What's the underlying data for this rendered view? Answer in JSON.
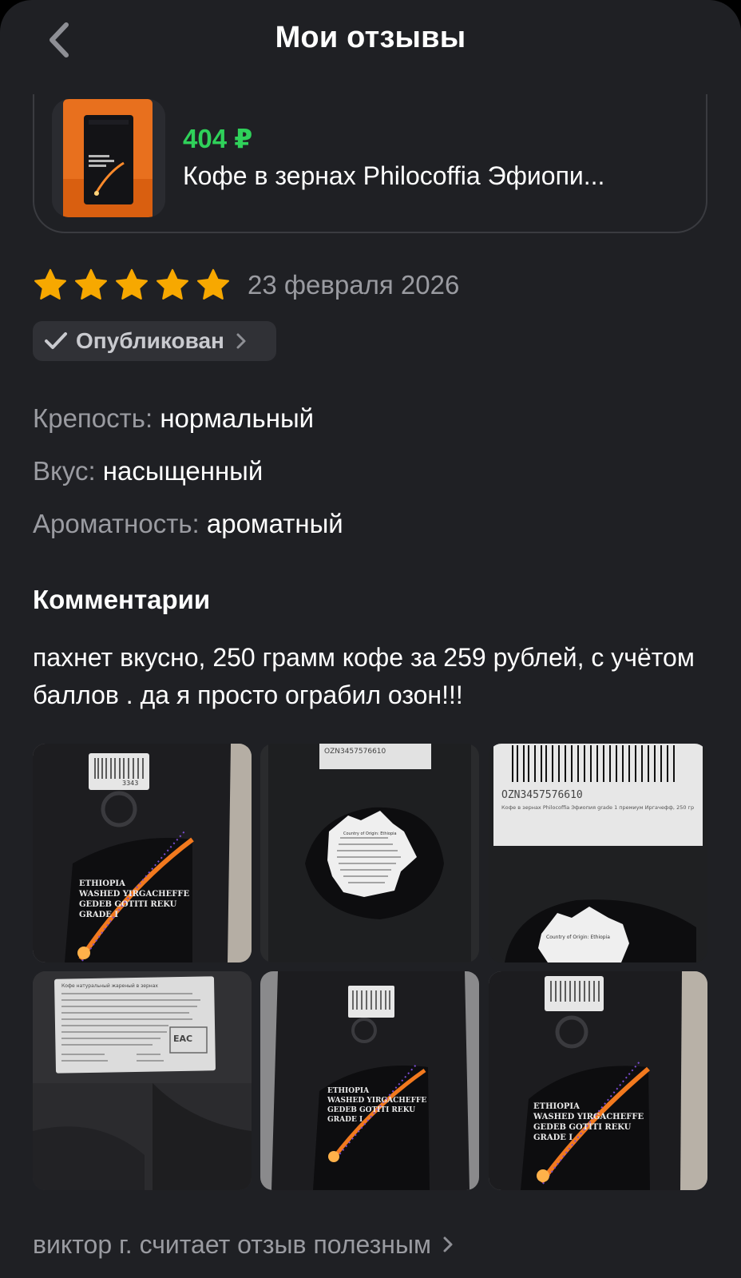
{
  "header": {
    "title": "Мои отзывы",
    "back_icon": "chevron-left-icon"
  },
  "product": {
    "price": "404 ₽",
    "name": "Кофе в зернах Philocoffia Эфиопи..."
  },
  "rating": {
    "stars": 5,
    "max_stars": 5,
    "date": "23 февраля 2026",
    "star_color": "#f7a800"
  },
  "status": {
    "label": "Опубликован",
    "icon": "checkmark-icon"
  },
  "attributes": [
    {
      "key": "Крепость:",
      "value": "нормальный"
    },
    {
      "key": "Вкус:",
      "value": "насыщенный"
    },
    {
      "key": "Ароматность:",
      "value": "ароматный"
    }
  ],
  "comments": {
    "title": "Комментарии",
    "text": "пахнет вкусно, 250 грамм кофе за 259 рублей, с учётом баллов . да я просто ограбил озон!!!"
  },
  "photos": [
    {
      "label_lines": [
        "ETHIOPIA",
        "WASHED YIRGACHEFFE",
        "GEDEB GOTITI REKU",
        "GRADE I"
      ],
      "barcode": "3343"
    },
    {
      "barcode_text": "OZN3457576610",
      "map_text": "Country of Origin: Ethiopia"
    },
    {
      "barcode_text": "OZN3457576610",
      "sticker_text": "Кофе в зернах Philocoffia Эфиопия grade 1 премиум Иргачефф, 250 гр",
      "map_text": "Country of Origin: Ethiopia"
    },
    {
      "label_text": "Кофе натуральный жареный в зернах",
      "eac": "EAC"
    },
    {
      "label_lines": [
        "ETHIOPIA",
        "WASHED YIRGACHEFFE",
        "GEDEB GOTITI REKU",
        "GRADE I"
      ]
    },
    {
      "label_lines": [
        "ETHIOPIA",
        "WASHED YIRGACHEFFE",
        "GEDEB GOTITI REKU",
        "GRADE I"
      ]
    }
  ],
  "footer": {
    "helpful_text": "виктор г. считает отзыв полезным"
  },
  "colors": {
    "background": "#1f2024",
    "price_green": "#2fd15a",
    "muted_text": "#9a9ba1",
    "badge_bg": "#303136"
  }
}
